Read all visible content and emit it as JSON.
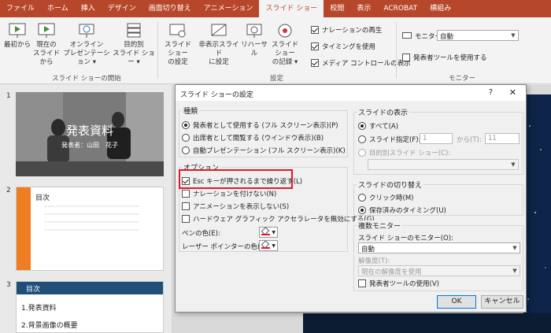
{
  "ribbon_tabs": [
    "ファイル",
    "ホーム",
    "挿入",
    "デザイン",
    "画面切り替え",
    "アニメーション",
    "スライド ショー",
    "校閲",
    "表示",
    "ACROBAT",
    "横組み"
  ],
  "ribbon": {
    "from_start": "最初から",
    "from_current_1": "現在の",
    "from_current_2": "スライドから",
    "online_1": "オンライン",
    "online_2": "プレゼンテーション ▾",
    "custom_1": "目的別",
    "custom_2": "スライド ショー ▾",
    "group_start": "スライド ショーの開始",
    "setup_1": "スライド ショー",
    "setup_2": "の設定",
    "hide_1": "非表示スライド",
    "hide_2": "に設定",
    "rehearse": "リハーサル",
    "record_1": "スライド ショー",
    "record_2": "の記録 ▾",
    "narration": "ナレーションの再生",
    "timing": "タイミングを使用",
    "media": "メディア コントロールの表示",
    "group_setup": "設定",
    "monitor_label": "モニター:",
    "monitor_value": "自動",
    "presenter_view": "発表者ツールを使用する",
    "group_monitor": "モニター"
  },
  "slides": {
    "n1": "1",
    "n2": "2",
    "n3": "3",
    "s1_title": "発表資料",
    "s1_sub": "発表者：山田　花子",
    "s2_title": "目次",
    "s3_title": "目次",
    "s3_item1": "1.発表資料",
    "s3_item2": "2.背景画像の概要"
  },
  "dialog": {
    "title": "スライド ショーの設定",
    "help": "?",
    "close": "✕",
    "type_title": "種類",
    "type_1": "発表者として使用する (フル スクリーン表示)(P)",
    "type_2": "出席者として閲覧する (ウインドウ表示)(B)",
    "type_3": "自動プレゼンテーション (フル スクリーン表示)(K)",
    "options_title": "オプション",
    "opt_loop": "Esc キーが押されるまで繰り返す(L)",
    "opt_no_narration": "ナレーションを付けない(N)",
    "opt_no_animation": "アニメーションを表示しない(S)",
    "opt_disable_hw": "ハードウェア グラフィック アクセラレータを無効にする(G)",
    "pen_color": "ペンの色(E):",
    "laser_color": "レーザー ポインターの色(R):",
    "show_title": "スライドの表示",
    "show_all": "すべて(A)",
    "show_range": "スライド指定(F):",
    "range_from": "1",
    "range_to_label": "から(T):",
    "range_to": "11",
    "show_custom": "目的別スライド ショー(C):",
    "advance_title": "スライドの切り替え",
    "advance_manual": "クリック時(M)",
    "advance_timing": "保存済みのタイミング(U)",
    "multi_title": "複数モニター",
    "monitor_label": "スライド ショーのモニター(O):",
    "monitor_value": "自動",
    "resolution_label": "解像度(T):",
    "resolution_value": "現在の解像度を使用",
    "presenter_tools": "発表者ツールの使用(V)",
    "ok": "OK",
    "cancel": "キャンセル"
  },
  "colors": {
    "accent": "#b7472a",
    "highlight": "#e0182c",
    "slide2_bar": "#ef7d22",
    "slide3_header": "#1f4e79"
  }
}
